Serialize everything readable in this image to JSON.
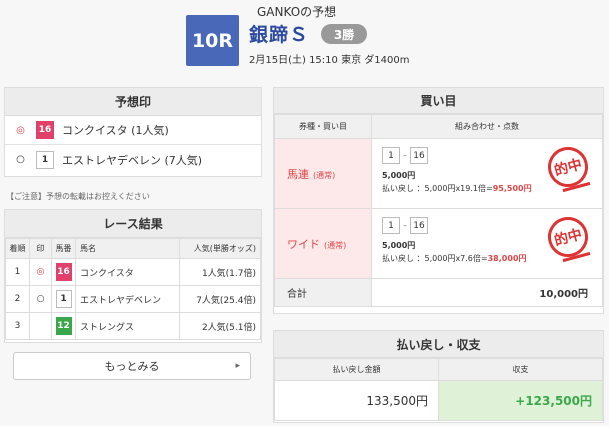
{
  "header": {
    "title": "GANKOの予想",
    "race_number": "10R",
    "race_name": "銀蹄Ｓ",
    "grade": "3勝",
    "info": "2月15日(土) 15:10 東京 ダ1400m"
  },
  "prediction": {
    "heading": "予想印",
    "rows": [
      {
        "mark": "◎",
        "num": "16",
        "name": "コンクイスタ (1人気)",
        "num_bg": "#e0406a",
        "num_fg": "#ffffff"
      },
      {
        "mark": "○",
        "num": "1",
        "name": "エストレヤデベレン (7人気)",
        "num_bg": "#ffffff",
        "num_fg": "#333333"
      }
    ]
  },
  "notice": "【ご注意】予想の転載はお控えください",
  "results": {
    "heading": "レース結果",
    "columns": [
      "着順",
      "印",
      "馬番",
      "馬名",
      "人気(単勝オッズ)"
    ],
    "rows": [
      {
        "rank": "1",
        "mark": "◎",
        "num": "16",
        "num_bg": "#e0406a",
        "name": "コンクイスタ",
        "pop": "1人気(1.7倍)"
      },
      {
        "rank": "2",
        "mark": "○",
        "num": "1",
        "num_bg": "#ffffff",
        "name": "エストレヤデベレン",
        "pop": "7人気(25.4倍)"
      },
      {
        "rank": "3",
        "mark": "",
        "num": "12",
        "num_bg": "#3aa84a",
        "name": "ストレングス",
        "pop": "2人気(5.1倍)"
      }
    ],
    "more_label": "もっとみる"
  },
  "bets": {
    "heading": "買い目",
    "columns": [
      "券種・買い目",
      "組み合わせ・点数"
    ],
    "rows": [
      {
        "type": "馬連",
        "sub": "(通常)",
        "a": "1",
        "b": "16",
        "amount": "5,000円",
        "ret_label": "払い戻し ：5,000円x19.1倍=",
        "ret_value": "95,500円",
        "stamp": "的中"
      },
      {
        "type": "ワイド",
        "sub": "(通常)",
        "a": "1",
        "b": "16",
        "amount": "5,000円",
        "ret_label": "払い戻し ：5,000円x7.6倍=",
        "ret_value": "38,000円",
        "stamp": "的中"
      }
    ],
    "total_label": "合計",
    "total_value": "10,000円"
  },
  "payout": {
    "heading": "払い戻し・収支",
    "columns": [
      "払い戻し金額",
      "収支"
    ],
    "refund": "133,500円",
    "balance": "+123,500円"
  }
}
